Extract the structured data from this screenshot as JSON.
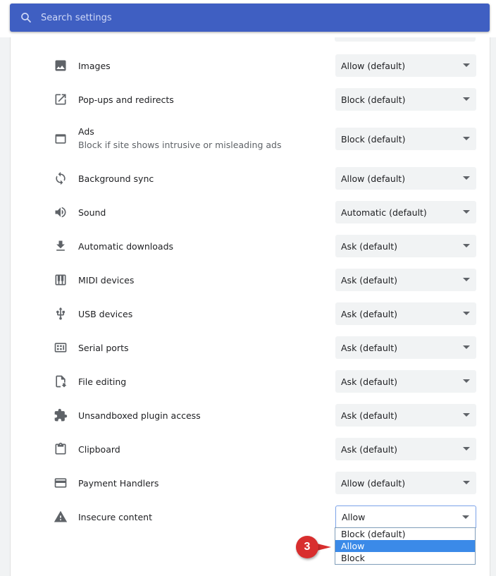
{
  "search": {
    "placeholder": "Search settings"
  },
  "settings": [
    {
      "label": "Images",
      "sublabel": "",
      "value": "Allow (default)",
      "icon": "image-icon"
    },
    {
      "label": "Pop-ups and redirects",
      "sublabel": "",
      "value": "Block (default)",
      "icon": "open-in-new-icon"
    },
    {
      "label": "Ads",
      "sublabel": "Block if site shows intrusive or misleading ads",
      "value": "Block (default)",
      "icon": "web-asset-icon"
    },
    {
      "label": "Background sync",
      "sublabel": "",
      "value": "Allow (default)",
      "icon": "sync-icon"
    },
    {
      "label": "Sound",
      "sublabel": "",
      "value": "Automatic (default)",
      "icon": "volume-icon"
    },
    {
      "label": "Automatic downloads",
      "sublabel": "",
      "value": "Ask (default)",
      "icon": "download-icon"
    },
    {
      "label": "MIDI devices",
      "sublabel": "",
      "value": "Ask (default)",
      "icon": "piano-icon"
    },
    {
      "label": "USB devices",
      "sublabel": "",
      "value": "Ask (default)",
      "icon": "usb-icon"
    },
    {
      "label": "Serial ports",
      "sublabel": "",
      "value": "Ask (default)",
      "icon": "serial-port-icon"
    },
    {
      "label": "File editing",
      "sublabel": "",
      "value": "Ask (default)",
      "icon": "file-edit-icon"
    },
    {
      "label": "Unsandboxed plugin access",
      "sublabel": "",
      "value": "Ask (default)",
      "icon": "puzzle-icon"
    },
    {
      "label": "Clipboard",
      "sublabel": "",
      "value": "Ask (default)",
      "icon": "clipboard-icon"
    },
    {
      "label": "Payment Handlers",
      "sublabel": "",
      "value": "Allow (default)",
      "icon": "credit-card-icon"
    },
    {
      "label": "Insecure content",
      "sublabel": "",
      "value": "Allow",
      "icon": "warning-icon"
    }
  ],
  "insecure_dropdown": {
    "options": [
      "Block (default)",
      "Allow",
      "Block"
    ],
    "selected": "Allow"
  },
  "annotation": {
    "number": "3",
    "color": "#d82e2e"
  },
  "colors": {
    "search_bar": "#3f5fc2",
    "select_bg": "#f1f3f4",
    "highlight": "#3b8ae8"
  }
}
